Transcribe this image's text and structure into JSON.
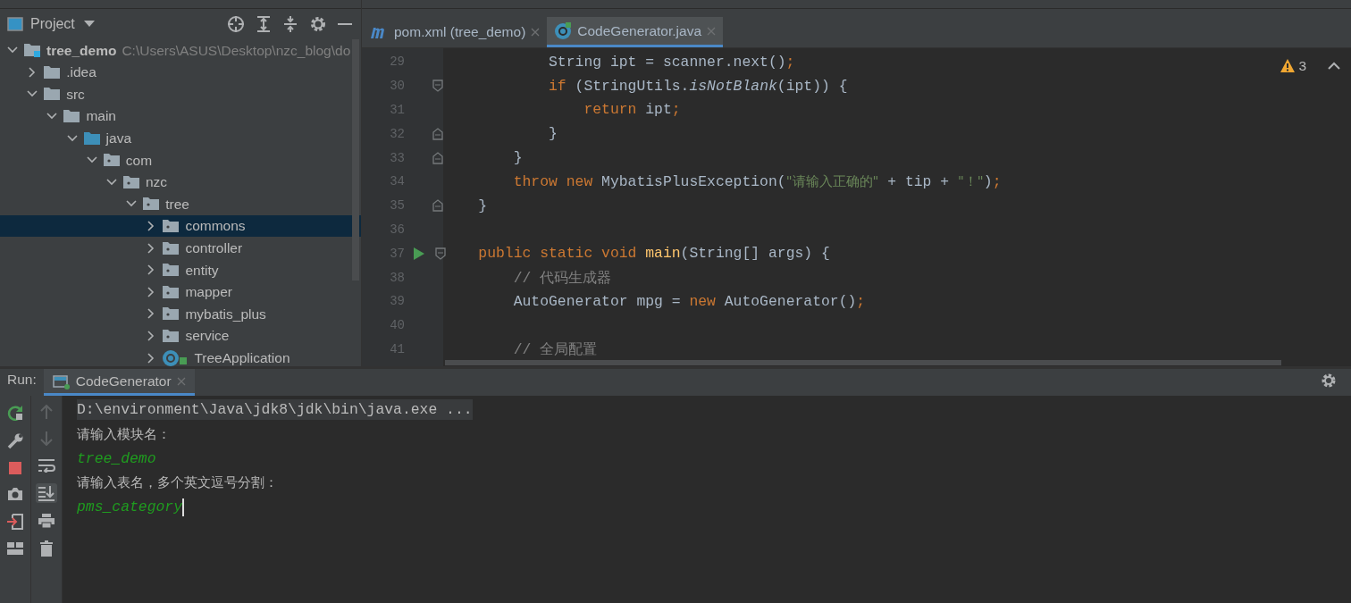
{
  "project_panel": {
    "title": "Project",
    "tree": [
      {
        "label": "tree_demo",
        "path": "C:\\Users\\ASUS\\Desktop\\nzc_blog\\do",
        "kind": "module",
        "expanded": true,
        "selected": false,
        "children": [
          {
            "label": ".idea",
            "kind": "folder",
            "expanded": false,
            "selected": false
          },
          {
            "label": "src",
            "kind": "folder",
            "expanded": true,
            "selected": false,
            "children": [
              {
                "label": "main",
                "kind": "folder",
                "expanded": true,
                "selected": false,
                "children": [
                  {
                    "label": "java",
                    "kind": "source",
                    "expanded": true,
                    "selected": false,
                    "children": [
                      {
                        "label": "com",
                        "kind": "package",
                        "expanded": true,
                        "selected": false,
                        "children": [
                          {
                            "label": "nzc",
                            "kind": "package",
                            "expanded": true,
                            "selected": false,
                            "children": [
                              {
                                "label": "tree",
                                "kind": "package",
                                "expanded": true,
                                "selected": false,
                                "children": [
                                  {
                                    "label": "commons",
                                    "kind": "package",
                                    "expanded": false,
                                    "selected": true
                                  },
                                  {
                                    "label": "controller",
                                    "kind": "package",
                                    "expanded": false,
                                    "selected": false
                                  },
                                  {
                                    "label": "entity",
                                    "kind": "package",
                                    "expanded": false,
                                    "selected": false
                                  },
                                  {
                                    "label": "mapper",
                                    "kind": "package",
                                    "expanded": false,
                                    "selected": false
                                  },
                                  {
                                    "label": "mybatis_plus",
                                    "kind": "package",
                                    "expanded": false,
                                    "selected": false
                                  },
                                  {
                                    "label": "service",
                                    "kind": "package",
                                    "expanded": false,
                                    "selected": false
                                  },
                                  {
                                    "label": "TreeApplication",
                                    "kind": "class",
                                    "expanded": false,
                                    "selected": false
                                  }
                                ]
                              }
                            ]
                          }
                        ]
                      }
                    ]
                  }
                ]
              }
            ]
          }
        ]
      }
    ]
  },
  "editor": {
    "tabs": [
      {
        "label": "pom.xml (tree_demo)",
        "kind": "maven",
        "selected": false
      },
      {
        "label": "CodeGenerator.java",
        "kind": "java",
        "selected": true
      }
    ],
    "warnings": "3",
    "lines": [
      {
        "number": "29",
        "tokens": [
          {
            "t": "            String ipt = scanner.next()",
            "kind": "plain"
          },
          {
            "t": ";",
            "kind": "keyword"
          }
        ]
      },
      {
        "number": "30",
        "markers": [
          {
            "kind": "fold_start"
          }
        ],
        "tokens": [
          {
            "t": "            if",
            "kind": "keyword"
          },
          {
            "t": " (StringUtils.",
            "kind": "plain"
          },
          {
            "t": "isNotBlank",
            "kind": "italic"
          },
          {
            "t": "(ipt)) {",
            "kind": "plain"
          }
        ]
      },
      {
        "number": "31",
        "tokens": [
          {
            "t": "                return",
            "kind": "keyword"
          },
          {
            "t": " ipt",
            "kind": "plain"
          },
          {
            "t": ";",
            "kind": "keyword"
          }
        ]
      },
      {
        "number": "32",
        "markers": [
          {
            "kind": "fold_end"
          }
        ],
        "tokens": [
          {
            "t": "            }",
            "kind": "plain"
          }
        ]
      },
      {
        "number": "33",
        "markers": [
          {
            "kind": "fold_end"
          }
        ],
        "tokens": [
          {
            "t": "        }",
            "kind": "plain"
          }
        ]
      },
      {
        "number": "34",
        "tokens": [
          {
            "t": "        throw new",
            "kind": "keyword"
          },
          {
            "t": " MybatisPlusException(",
            "kind": "plain"
          },
          {
            "t": "\"请输入正确的\"",
            "kind": "string"
          },
          {
            "t": " + tip + ",
            "kind": "plain"
          },
          {
            "t": "\"！\"",
            "kind": "string"
          },
          {
            "t": ")",
            "kind": "plain"
          },
          {
            "t": ";",
            "kind": "keyword"
          }
        ]
      },
      {
        "number": "35",
        "markers": [
          {
            "kind": "fold_end"
          }
        ],
        "tokens": [
          {
            "t": "    }",
            "kind": "plain"
          }
        ]
      },
      {
        "number": "36"
      },
      {
        "number": "37",
        "markers": [
          {
            "kind": "run"
          },
          {
            "kind": "fold_start"
          }
        ],
        "tokens": [
          {
            "t": "    public static void ",
            "kind": "keyword"
          },
          {
            "t": "main",
            "kind": "method"
          },
          {
            "t": "(String[] args) {",
            "kind": "plain"
          }
        ]
      },
      {
        "number": "38",
        "tokens": [
          {
            "t": "        // 代码生成器",
            "kind": "comment"
          }
        ]
      },
      {
        "number": "39",
        "tokens": [
          {
            "t": "        AutoGenerator mpg = ",
            "kind": "plain"
          },
          {
            "t": "new",
            "kind": "keyword"
          },
          {
            "t": " AutoGenerator()",
            "kind": "plain"
          },
          {
            "t": ";",
            "kind": "keyword"
          }
        ]
      },
      {
        "number": "40"
      },
      {
        "number": "41",
        "tokens": [
          {
            "t": "        // 全局配置",
            "kind": "comment"
          }
        ]
      }
    ]
  },
  "run_panel": {
    "label": "Run:",
    "tabs": [
      {
        "label": "CodeGenerator",
        "selected": true
      }
    ],
    "console": [
      {
        "text": "D:\\environment\\Java\\jdk8\\jdk\\bin\\java.exe ...",
        "kind": "command",
        "cursor": false
      },
      {
        "text": "请输入模块名：",
        "kind": "prompt",
        "cursor": false
      },
      {
        "text": "tree_demo",
        "kind": "input",
        "cursor": false
      },
      {
        "text": "请输入表名，多个英文逗号分割：",
        "kind": "prompt",
        "cursor": false
      },
      {
        "text": "pms_category",
        "kind": "input",
        "cursor": true
      }
    ]
  }
}
